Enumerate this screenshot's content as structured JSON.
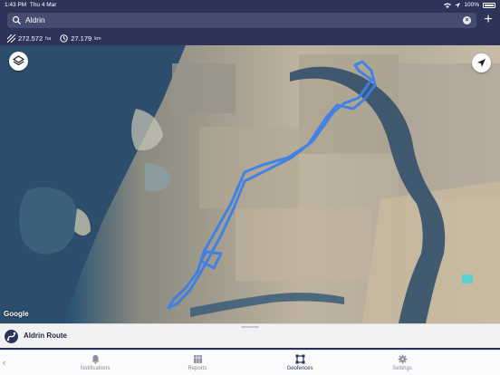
{
  "status_bar": {
    "time": "1:43 PM",
    "date": "Thu 4 Mar",
    "battery": "100%"
  },
  "search": {
    "value": "Aldrin",
    "clear_icon": "clear-icon"
  },
  "add_label": "+",
  "stats": {
    "area_value": "272.572",
    "area_unit": "ha",
    "distance_value": "27.179",
    "distance_unit": "km"
  },
  "map": {
    "attribution": "Google",
    "route_color": "#3d7fe6",
    "icons": [
      "layers-icon",
      "locate-arrow-icon"
    ]
  },
  "route": {
    "name": "Aldrin Route"
  },
  "tabs": [
    {
      "label": "Notifications",
      "icon": "bell-icon"
    },
    {
      "label": "Reports",
      "icon": "reports-icon"
    },
    {
      "label": "Geofences",
      "icon": "geofence-icon",
      "active": true
    },
    {
      "label": "Settings",
      "icon": "gear-icon"
    }
  ],
  "colors": {
    "header": "#2e3359",
    "accent": "#2e3359",
    "route": "#3d7fe6"
  }
}
